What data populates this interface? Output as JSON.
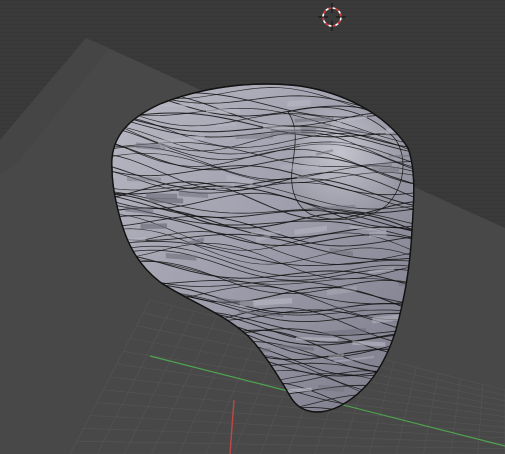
{
  "app": {
    "type": "3d-viewport",
    "view": "user-perspective"
  },
  "icons": {
    "cursor": "3d-cursor-icon"
  },
  "scene": {
    "object": "sculpted-wavy-mesh",
    "shading": "solid",
    "grid": {
      "visible": true
    },
    "axes": {
      "x_color": "#c24747",
      "y_color": "#4fa34f"
    },
    "colors": {
      "background": "#393939",
      "backdrop_plane": "#4a4a4a",
      "mesh_base": "#9a9aa8",
      "mesh_light": "#b9b9c5",
      "mesh_dark": "#6c6c78",
      "edges": "#101010"
    }
  }
}
